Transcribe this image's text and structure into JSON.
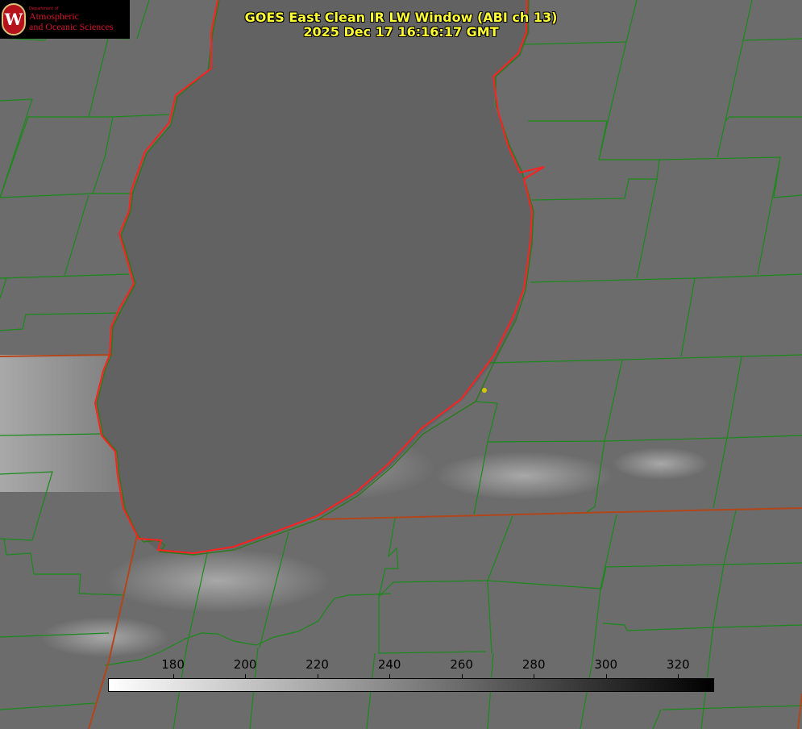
{
  "header": {
    "title_line1": "GOES East Clean IR LW Window (ABI ch 13)",
    "title_line2": "2025 Dec 17 16:16:17 GMT"
  },
  "logo": {
    "seal_letter": "W",
    "dept": "Department of",
    "line1": "Atmospheric",
    "line2": "and Oceanic Sciences",
    "color": "#d4132a"
  },
  "colorbar": {
    "ticks": [
      {
        "value": 180,
        "label": "180"
      },
      {
        "value": 200,
        "label": "200"
      },
      {
        "value": 220,
        "label": "220"
      },
      {
        "value": 240,
        "label": "240"
      },
      {
        "value": 260,
        "label": "260"
      },
      {
        "value": 280,
        "label": "280"
      },
      {
        "value": 300,
        "label": "300"
      },
      {
        "value": 320,
        "label": "320"
      }
    ],
    "min": 162,
    "max": 330,
    "color_low": "#ffffff",
    "color_high": "#000000"
  },
  "map": {
    "county_line_color": "#1a8a1a",
    "state_line_color": "#b2461a",
    "lake_outline_color": "#ff2020",
    "point_color": "#d4c800"
  }
}
